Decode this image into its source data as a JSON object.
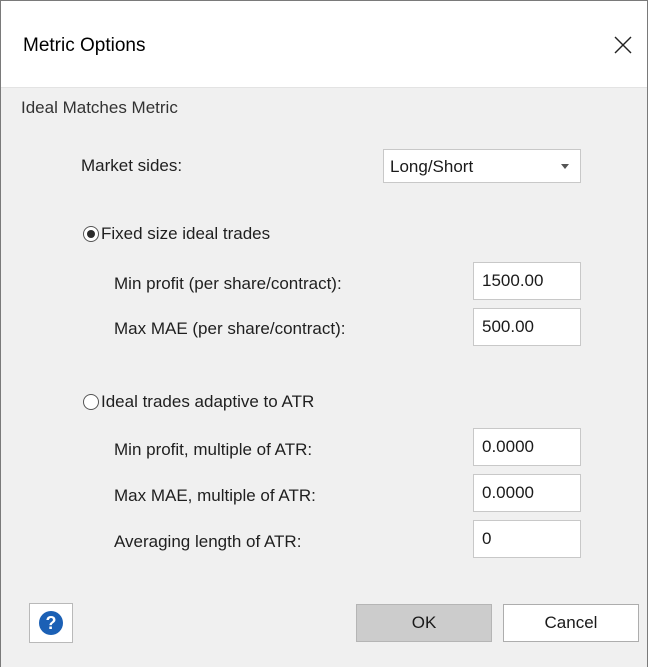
{
  "window": {
    "title": "Metric Options",
    "close_icon": "close-icon"
  },
  "group": {
    "title": "Ideal Matches Metric"
  },
  "market_sides": {
    "label": "Market sides:",
    "value": "Long/Short",
    "icon": "chevron-down-icon"
  },
  "fixed": {
    "label": "Fixed size ideal trades",
    "selected": true,
    "min_profit_label": "Min profit (per share/contract):",
    "min_profit_value": "1500.00",
    "max_mae_label": "Max MAE (per share/contract):",
    "max_mae_value": "500.00"
  },
  "adaptive": {
    "label": "Ideal trades adaptive to ATR",
    "selected": false,
    "min_profit_label": "Min profit, multiple of ATR:",
    "min_profit_value": "0.0000",
    "max_mae_label": "Max MAE, multiple of ATR:",
    "max_mae_value": "0.0000",
    "avg_len_label": "Averaging length of ATR:",
    "avg_len_value": "0"
  },
  "footer": {
    "help_icon": "help-icon",
    "help_glyph": "?",
    "ok_label": "OK",
    "cancel_label": "Cancel"
  },
  "colors": {
    "help_icon": "#1b60b5",
    "ok_button": "#cccccc",
    "content_background": "#f0f0f0"
  }
}
